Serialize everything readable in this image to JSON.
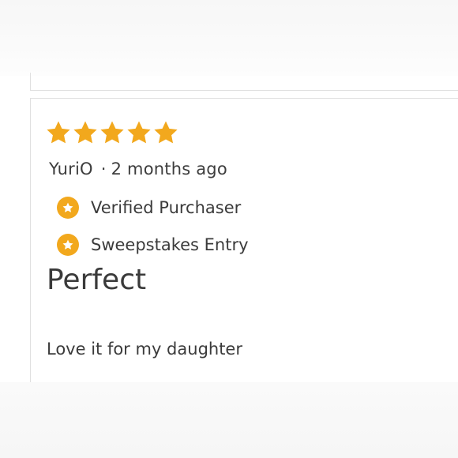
{
  "review": {
    "rating": 5,
    "rating_max": 5,
    "author": "YuriO",
    "separator": "·",
    "time_ago": "2 months ago",
    "badges": [
      {
        "label": "Verified Purchaser",
        "icon": "star-badge-icon"
      },
      {
        "label": "Sweepstakes Entry",
        "icon": "star-badge-icon"
      }
    ],
    "title": "Perfect",
    "body": "Love it for my daughter"
  },
  "colors": {
    "star": "#f2a81d",
    "badge": "#f2a81d",
    "text": "#3b3b3b",
    "border": "#e0e0e0"
  }
}
